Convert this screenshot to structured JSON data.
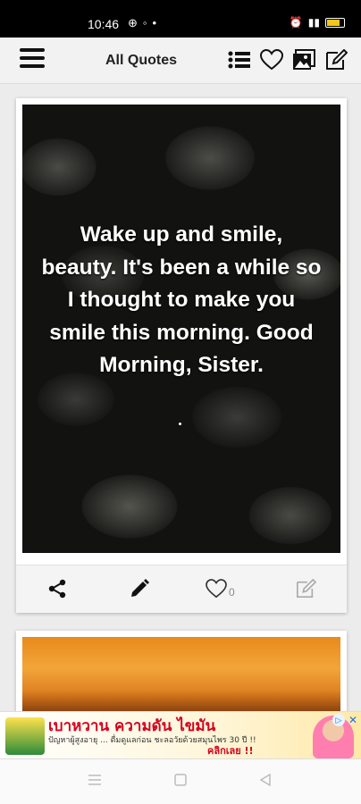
{
  "status_bar": {
    "time": "10:46",
    "icons": [
      "message-icon",
      "notification-dot-icon",
      "alarm-icon",
      "signal-icon",
      "battery-icon"
    ]
  },
  "app_bar": {
    "title": "All Quotes",
    "actions": [
      "list-icon",
      "heart-icon",
      "gallery-icon",
      "edit-icon"
    ]
  },
  "quote_card": {
    "text": "Wake up and smile, beauty. It's been a while so I thought to make you smile this morning. Good Morning, Sister.",
    "like_count": "0",
    "actions": [
      "share-icon",
      "pencil-icon",
      "heart-outline-icon",
      "edit-box-icon"
    ]
  },
  "ad_banner": {
    "headline": "เบาหวาน ความดัน ไขมัน",
    "subtext": "ปัญหาผู้สูงอายุ ... ดื่มดูแลก่อน ชะลอวัยด้วยสมุนไพร 30 ปี !!",
    "cta": "คลิกเลย !!"
  },
  "nav_bar": {
    "buttons": [
      "menu-nav-icon",
      "home-nav-icon",
      "back-nav-icon"
    ]
  }
}
